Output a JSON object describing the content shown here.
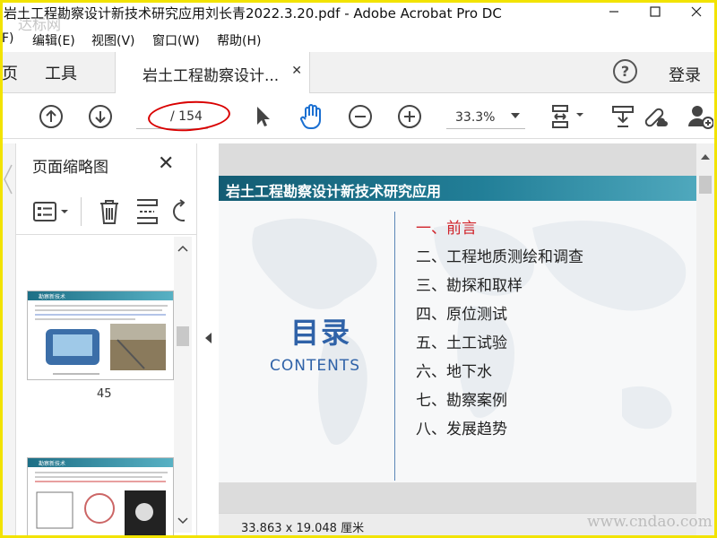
{
  "window": {
    "title": "岩土工程勘察设计新技术研究应用刘长青2022.3.20.pdf - Adobe Acrobat Pro DC"
  },
  "menu": [
    "F)",
    "编辑(E)",
    "视图(V)",
    "窗口(W)",
    "帮助(H)"
  ],
  "tabs": {
    "home_partial": "页",
    "tools": "工具",
    "document": "岩土工程勘察设计...",
    "help": "?",
    "login": "登录"
  },
  "toolbar": {
    "current_page": "",
    "total_pages": "/ 154",
    "zoom": "33.3%"
  },
  "left_panel": {
    "title": "页面缩略图",
    "thumbnails": [
      {
        "label": "45",
        "header": "勘察新技术"
      },
      {
        "label": "",
        "header": "勘察新技术"
      }
    ]
  },
  "document": {
    "banner": "岩土工程勘察设计新技术研究应用",
    "heading": "目录",
    "subheading": "CONTENTS",
    "toc": [
      "一、前言",
      "二、工程地质测绘和调查",
      "三、勘探和取样",
      "四、原位测试",
      "五、土工试验",
      "六、地下水",
      "七、勘察案例",
      "八、发展趋势"
    ]
  },
  "status": {
    "page_size": "33.863 x 19.048 厘米"
  },
  "watermarks": {
    "top": "达标网",
    "bottom": "www.cndao.com"
  },
  "colors": {
    "banner": "#1d6f86",
    "accent_blue": "#2f62a8",
    "active_item": "#d0232a",
    "highlight_ellipse": "#d90000",
    "frame": "#f2e300"
  }
}
